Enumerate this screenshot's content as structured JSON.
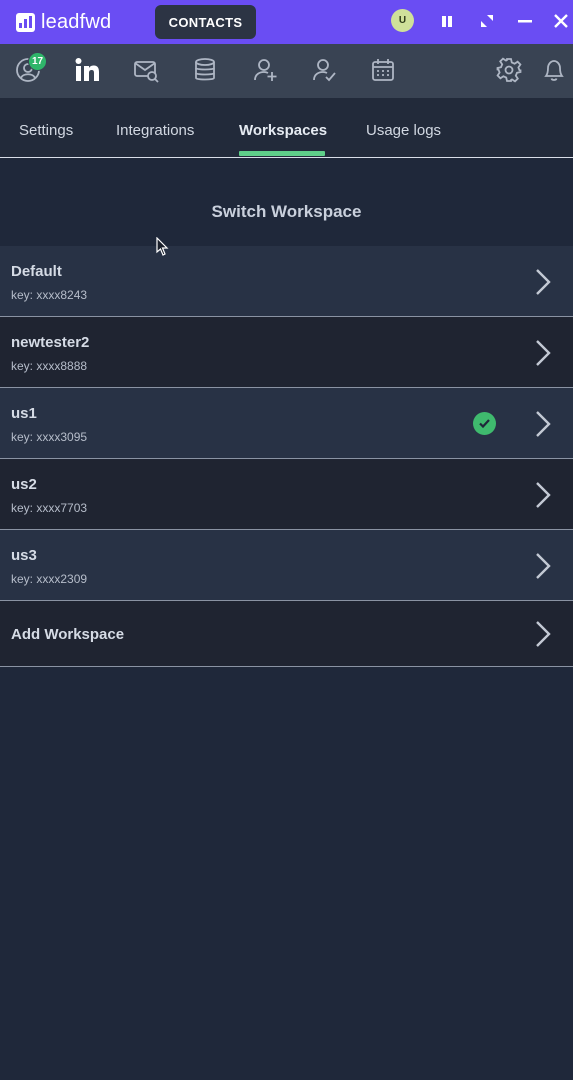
{
  "titlebar": {
    "brand": "leadfwd",
    "section_button": "CONTACTS",
    "avatar_initial": "U",
    "accent_color": "#6a4df3"
  },
  "toolbar": {
    "badge_count": "17",
    "icons": [
      "profile-icon",
      "linkedin-icon",
      "mail-search-icon",
      "database-icon",
      "add-user-icon",
      "user-check-icon",
      "calendar-icon",
      "settings-icon",
      "bell-icon"
    ]
  },
  "tabs": [
    {
      "label": "Settings"
    },
    {
      "label": "Integrations"
    },
    {
      "label": "Workspaces",
      "active": true
    },
    {
      "label": "Usage logs"
    }
  ],
  "heading": "Switch Workspace",
  "workspaces": [
    {
      "name": "Default",
      "key": "key: xxxx8243"
    },
    {
      "name": "newtester2",
      "key": "key: xxxx8888"
    },
    {
      "name": "us1",
      "key": "key: xxxx3095",
      "selected": true
    },
    {
      "name": "us2",
      "key": "key: xxxx7703"
    },
    {
      "name": "us3",
      "key": "key: xxxx2309"
    }
  ],
  "add_workspace_label": "Add Workspace",
  "colors": {
    "tab_underline": "#5fd08a",
    "selected_check": "#3fba6e",
    "badge": "#2fb56a"
  }
}
